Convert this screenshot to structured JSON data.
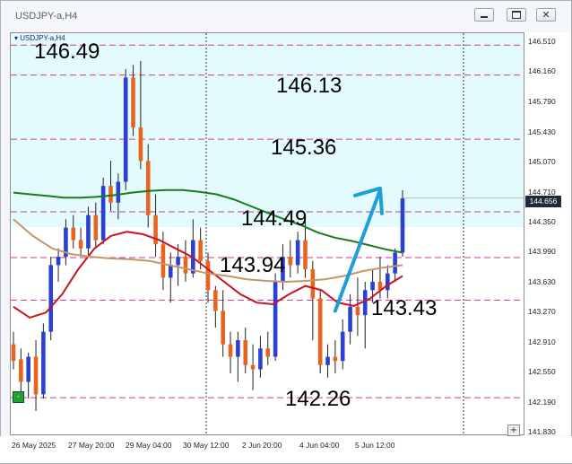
{
  "window": {
    "title": "USDJPY-a,H4",
    "minimize_icon": "minimize-icon",
    "restore_icon": "restore-icon",
    "close_icon": "close-icon"
  },
  "chart_label": "USDJPY-a,H4",
  "annotations": {
    "a1": "146.49",
    "a2": "146.13",
    "a3": "145.36",
    "a4": "144.49",
    "a5": "143.94",
    "a6": "143.43",
    "a7": "142.26"
  },
  "current_price": "144.656",
  "colors": {
    "bull": "#2a3fd4",
    "bear": "#e8641e",
    "ma_green": "#1c7a1c",
    "ma_red": "#c8141e",
    "ma_tan": "#c4966a",
    "arrow": "#1e9fd8",
    "level_line": "#d0359a",
    "band": "#e4fbfd"
  },
  "chart_data": {
    "type": "candlestick",
    "title": "USDJPY-a,H4",
    "ylim": [
      141.83,
      146.6
    ],
    "y_ticks": [
      "146.510",
      "146.160",
      "145.790",
      "145.430",
      "145.070",
      "144.710",
      "144.350",
      "143.990",
      "143.630",
      "143.270",
      "142.910",
      "142.550",
      "142.190",
      "141.830"
    ],
    "x_ticks": [
      "26 May 2025",
      "27 May 20:00",
      "29 May 04:00",
      "30 May 12:00",
      "2 Jun 20:00",
      "4 Jun 04:00",
      "5 Jun 12:00"
    ],
    "levels": [
      146.49,
      146.13,
      145.36,
      144.49,
      143.94,
      143.43,
      142.26
    ],
    "shaded_zone": [
      144.35,
      146.6
    ],
    "candles": [
      [
        142.9,
        143.05,
        142.6,
        142.7
      ],
      [
        142.72,
        142.85,
        142.3,
        142.45
      ],
      [
        142.45,
        142.8,
        142.25,
        142.75
      ],
      [
        142.75,
        142.95,
        142.1,
        142.3
      ],
      [
        142.3,
        143.15,
        142.25,
        143.05
      ],
      [
        143.05,
        143.95,
        142.95,
        143.85
      ],
      [
        143.85,
        144.05,
        143.65,
        143.95
      ],
      [
        143.95,
        144.4,
        143.85,
        144.3
      ],
      [
        144.3,
        144.45,
        144.05,
        144.15
      ],
      [
        144.15,
        144.3,
        143.95,
        144.05
      ],
      [
        144.05,
        144.55,
        143.95,
        144.45
      ],
      [
        144.45,
        144.6,
        144.05,
        144.15
      ],
      [
        144.15,
        144.9,
        144.1,
        144.8
      ],
      [
        144.8,
        145.1,
        144.5,
        144.6
      ],
      [
        144.6,
        144.95,
        144.4,
        144.85
      ],
      [
        144.85,
        146.2,
        144.75,
        146.1
      ],
      [
        146.1,
        146.25,
        145.4,
        145.5
      ],
      [
        145.5,
        146.3,
        145.0,
        145.1
      ],
      [
        145.1,
        145.3,
        144.3,
        144.45
      ],
      [
        144.45,
        144.7,
        143.95,
        144.1
      ],
      [
        144.1,
        144.25,
        143.55,
        143.7
      ],
      [
        143.7,
        144.0,
        143.4,
        143.85
      ],
      [
        143.85,
        144.1,
        143.6,
        143.95
      ],
      [
        143.95,
        144.15,
        143.65,
        143.75
      ],
      [
        143.75,
        144.4,
        143.7,
        144.15
      ],
      [
        144.15,
        144.3,
        143.8,
        143.9
      ],
      [
        143.9,
        144.0,
        143.4,
        143.55
      ],
      [
        143.55,
        143.6,
        143.1,
        143.3
      ],
      [
        143.3,
        143.55,
        142.75,
        142.9
      ],
      [
        142.9,
        143.05,
        142.55,
        142.75
      ],
      [
        142.75,
        143.05,
        142.45,
        142.95
      ],
      [
        142.95,
        143.1,
        142.55,
        142.65
      ],
      [
        142.65,
        142.9,
        142.35,
        142.6
      ],
      [
        142.6,
        143.0,
        142.5,
        142.85
      ],
      [
        142.85,
        143.05,
        142.65,
        142.75
      ],
      [
        142.75,
        143.75,
        142.7,
        143.65
      ],
      [
        143.65,
        144.1,
        143.55,
        143.95
      ],
      [
        143.95,
        144.15,
        143.7,
        143.85
      ],
      [
        143.85,
        144.25,
        143.75,
        144.15
      ],
      [
        144.15,
        144.4,
        143.7,
        143.8
      ],
      [
        143.8,
        143.9,
        142.95,
        143.45
      ],
      [
        143.45,
        143.55,
        142.55,
        142.65
      ],
      [
        142.65,
        142.9,
        142.5,
        142.75
      ],
      [
        142.75,
        142.95,
        142.55,
        142.7
      ],
      [
        142.7,
        143.2,
        142.6,
        143.05
      ],
      [
        143.05,
        143.5,
        142.9,
        143.35
      ],
      [
        143.35,
        143.7,
        143.0,
        143.25
      ],
      [
        143.25,
        143.65,
        142.85,
        143.55
      ],
      [
        143.55,
        143.8,
        143.4,
        143.65
      ],
      [
        143.65,
        143.95,
        143.45,
        143.55
      ],
      [
        143.55,
        143.85,
        143.45,
        143.75
      ],
      [
        143.75,
        144.05,
        143.65,
        144.0
      ],
      [
        144.0,
        144.75,
        143.95,
        144.65
      ]
    ],
    "series": [
      {
        "values": [
          144.72,
          144.7,
          144.68,
          144.66,
          144.66,
          144.67,
          144.69,
          144.72,
          144.74,
          144.75,
          144.75,
          144.73,
          144.7,
          144.64,
          144.56,
          144.48,
          144.4,
          144.33,
          144.24,
          144.18,
          144.14,
          144.09,
          144.04,
          144.0
        ]
      },
      {
        "values": [
          143.35,
          143.22,
          143.28,
          143.5,
          143.8,
          144.05,
          144.2,
          144.25,
          144.22,
          144.15,
          144.05,
          143.95,
          143.8,
          143.65,
          143.5,
          143.4,
          143.38,
          143.5,
          143.6,
          143.55,
          143.4,
          143.36,
          143.45,
          143.6,
          143.72
        ]
      },
      {
        "values": [
          144.4,
          144.2,
          144.05,
          143.98,
          143.95,
          143.93,
          143.92,
          143.9,
          143.85,
          143.8,
          143.75,
          143.72,
          143.68,
          143.66,
          143.65,
          143.66,
          143.68,
          143.72,
          143.78,
          143.82,
          143.85
        ]
      }
    ],
    "arrow": {
      "from": [
        43,
        143.3
      ],
      "to": [
        49,
        144.75
      ]
    }
  }
}
